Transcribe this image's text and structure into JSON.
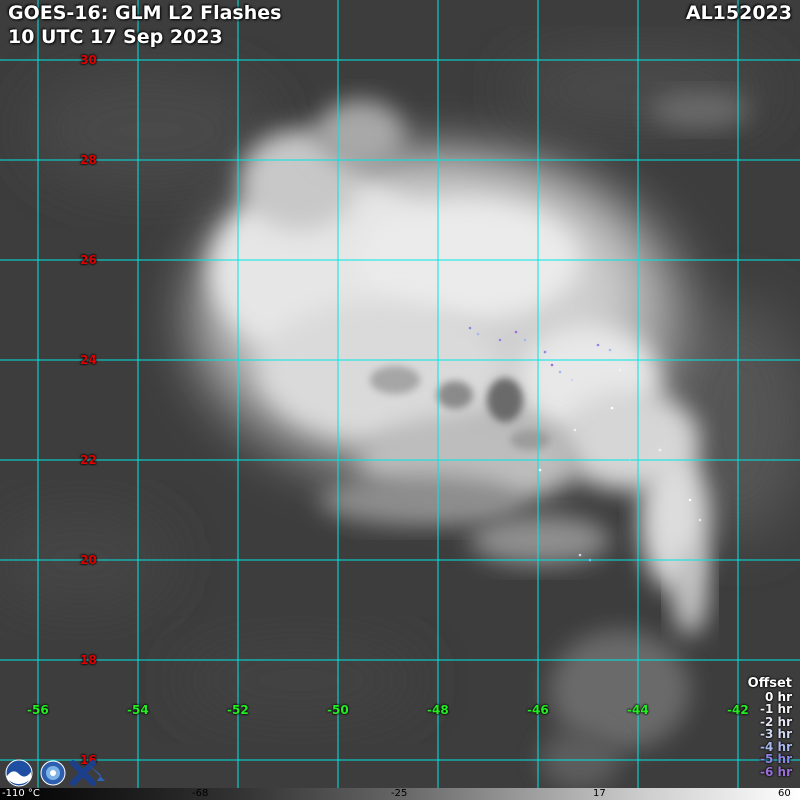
{
  "header": {
    "title_line1": "GOES-16: GLM L2 Flashes",
    "title_line2": "10 UTC 17 Sep 2023",
    "storm_id": "AL152023"
  },
  "grid": {
    "latitudes": [
      "30",
      "28",
      "26",
      "24",
      "22",
      "20",
      "18",
      "16"
    ],
    "longitudes": [
      "-56",
      "-54",
      "-52",
      "-50",
      "-48",
      "-46",
      "-44",
      "-42"
    ],
    "line_color": "#00e5e5",
    "lat_label_color": "#e00000",
    "lon_label_color": "#22ee22"
  },
  "legend": {
    "heading": "Offset",
    "entries": [
      {
        "label": "0 hr",
        "color": "#ffffff"
      },
      {
        "label": "-1 hr",
        "color": "#f2f2f2"
      },
      {
        "label": "-2 hr",
        "color": "#e6e6f4"
      },
      {
        "label": "-3 hr",
        "color": "#cfd8f0"
      },
      {
        "label": "-4 hr",
        "color": "#a9b8ee"
      },
      {
        "label": "-5 hr",
        "color": "#8d86e6"
      },
      {
        "label": "-6 hr",
        "color": "#9a70d8"
      }
    ]
  },
  "colorbar": {
    "unit_label": "-110 °C",
    "ticks": [
      "-68",
      "-25",
      "17",
      "60"
    ]
  },
  "logos": {
    "icons": [
      "noaa-logo-icon",
      "nesdis-logo-icon",
      "cira-logo-icon"
    ]
  }
}
